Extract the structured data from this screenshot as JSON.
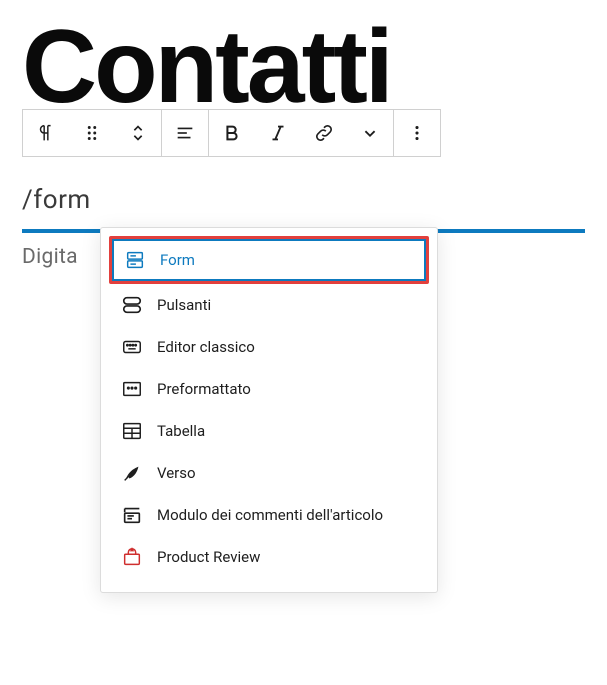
{
  "page_title": "Contatti",
  "toolbar": {
    "group1": [
      "paragraph",
      "drag",
      "move"
    ],
    "group2": [
      "align"
    ],
    "group3": [
      "bold",
      "italic",
      "link",
      "more-formatting"
    ],
    "group4": [
      "options"
    ]
  },
  "slash_input": "/form",
  "below_placeholder": "Digita",
  "popover": {
    "items": [
      {
        "icon": "form-icon",
        "label": "Form",
        "selected": true
      },
      {
        "icon": "buttons-icon",
        "label": "Pulsanti",
        "selected": false
      },
      {
        "icon": "keyboard-icon",
        "label": "Editor classico",
        "selected": false
      },
      {
        "icon": "preformatted-icon",
        "label": "Preformattato",
        "selected": false
      },
      {
        "icon": "table-icon",
        "label": "Tabella",
        "selected": false
      },
      {
        "icon": "quill-icon",
        "label": "Verso",
        "selected": false
      },
      {
        "icon": "comments-icon",
        "label": "Modulo dei commenti dell'articolo",
        "selected": false
      },
      {
        "icon": "product-review-icon",
        "label": "Product Review",
        "selected": false
      }
    ]
  }
}
